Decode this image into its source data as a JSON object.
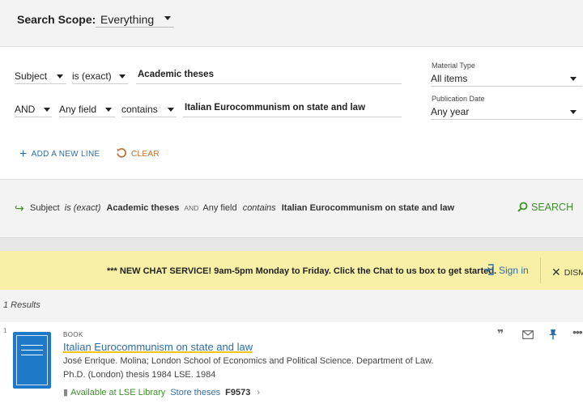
{
  "scope": {
    "label": "Search Scope:",
    "value": "Everything"
  },
  "advanced": {
    "row1": {
      "field": "Subject",
      "operator": "is (exact)",
      "value": "Academic theses"
    },
    "row2": {
      "boolean": "AND",
      "field": "Any field",
      "operator": "contains",
      "value": "Italian Eurocommunism on state and law"
    },
    "material_type": {
      "label": "Material Type",
      "value": "All items"
    },
    "publication_date": {
      "label": "Publication Date",
      "value": "Any year"
    },
    "add_line": "ADD A NEW LINE",
    "clear": "CLEAR"
  },
  "summary": {
    "field1": "Subject",
    "op1": "is (exact)",
    "val1": "Academic theses",
    "bool": "AND",
    "field2": "Any field",
    "op2": "contains",
    "val2": "Italian Eurocommunism on state and law",
    "search": "SEARCH"
  },
  "banner": {
    "message": "*** NEW CHAT SERVICE! 9am-5pm Monday to Friday. Click the Chat to us box to get started.",
    "sign_in": "Sign in",
    "dismiss": "DISMISS"
  },
  "results": {
    "count": "1 Results",
    "items": [
      {
        "index": "1",
        "type": "BOOK",
        "title": "Italian Eurocommunism on state and law",
        "authors": "José Enrique. Molina; London School of Economics and Political Science. Department of Law.",
        "details": "Ph.D. (London) thesis 1984 LSE. 1984",
        "availability": "Available at LSE Library",
        "location": "Store theses",
        "call_number": "F9573"
      }
    ]
  },
  "colors": {
    "accent_blue": "#2e6da8",
    "green": "#3f8f2b",
    "orange": "#c86b2a",
    "banner_bg": "#f7f0a6"
  }
}
